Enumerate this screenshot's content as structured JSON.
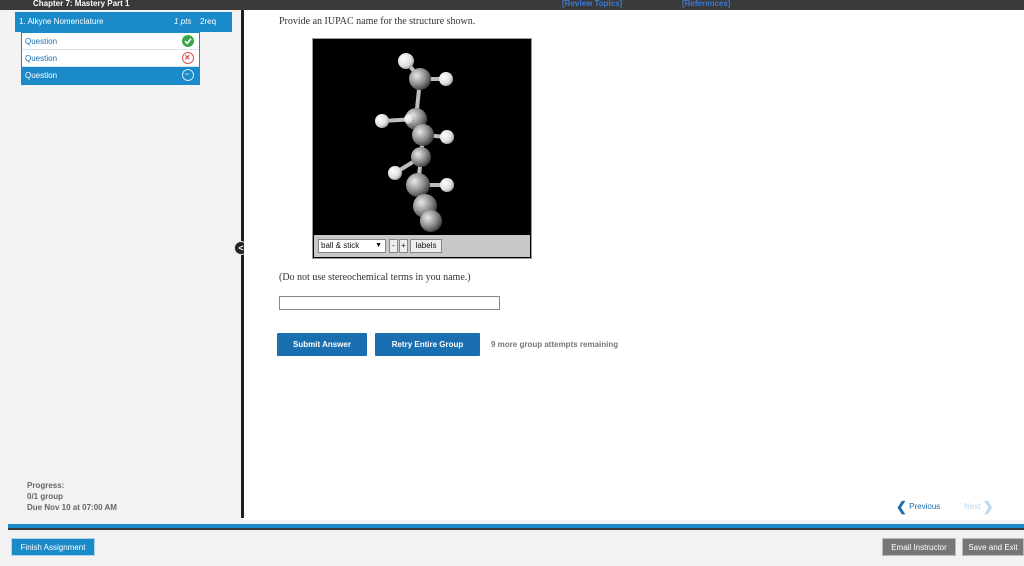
{
  "topbar": {
    "chapter": "Chapter 7: Mastery Part 1",
    "review_topics": "[Review Topics]",
    "references": "[References]"
  },
  "sidebar": {
    "question_title": "1. Alkyne Nomenclature",
    "points": "1 pts",
    "req": "2req",
    "questions": [
      {
        "label": "Question",
        "status": "correct"
      },
      {
        "label": "Question",
        "status": "incorrect"
      },
      {
        "label": "Question",
        "status": "current"
      }
    ],
    "progress_label": "Progress:",
    "progress_value": "0/1 group",
    "due": "Due Nov 10 at 07:00 AM",
    "collapse_icon": "<"
  },
  "main": {
    "prompt": "Provide an IUPAC name for the structure shown.",
    "viewer": {
      "mode_select": "ball & stick",
      "minus": "-",
      "plus": "+",
      "labels": "labels"
    },
    "hint": "(Do not use stereochemical terms in you name.)",
    "answer_value": "",
    "submit_label": "Submit Answer",
    "retry_label": "Retry Entire Group",
    "attempts_text": "9 more group attempts remaining",
    "previous_label": "Previous",
    "next_label": "Next"
  },
  "footer": {
    "finish_label": "Finish Assignment",
    "email_label": "Email Instructor",
    "save_exit_label": "Save and Exit"
  },
  "colors": {
    "accent": "#1a8ac9",
    "button_blue": "#1a6fb0",
    "topbar": "#3a3a3a",
    "correct": "#3aa84a",
    "incorrect": "#d9534f"
  }
}
